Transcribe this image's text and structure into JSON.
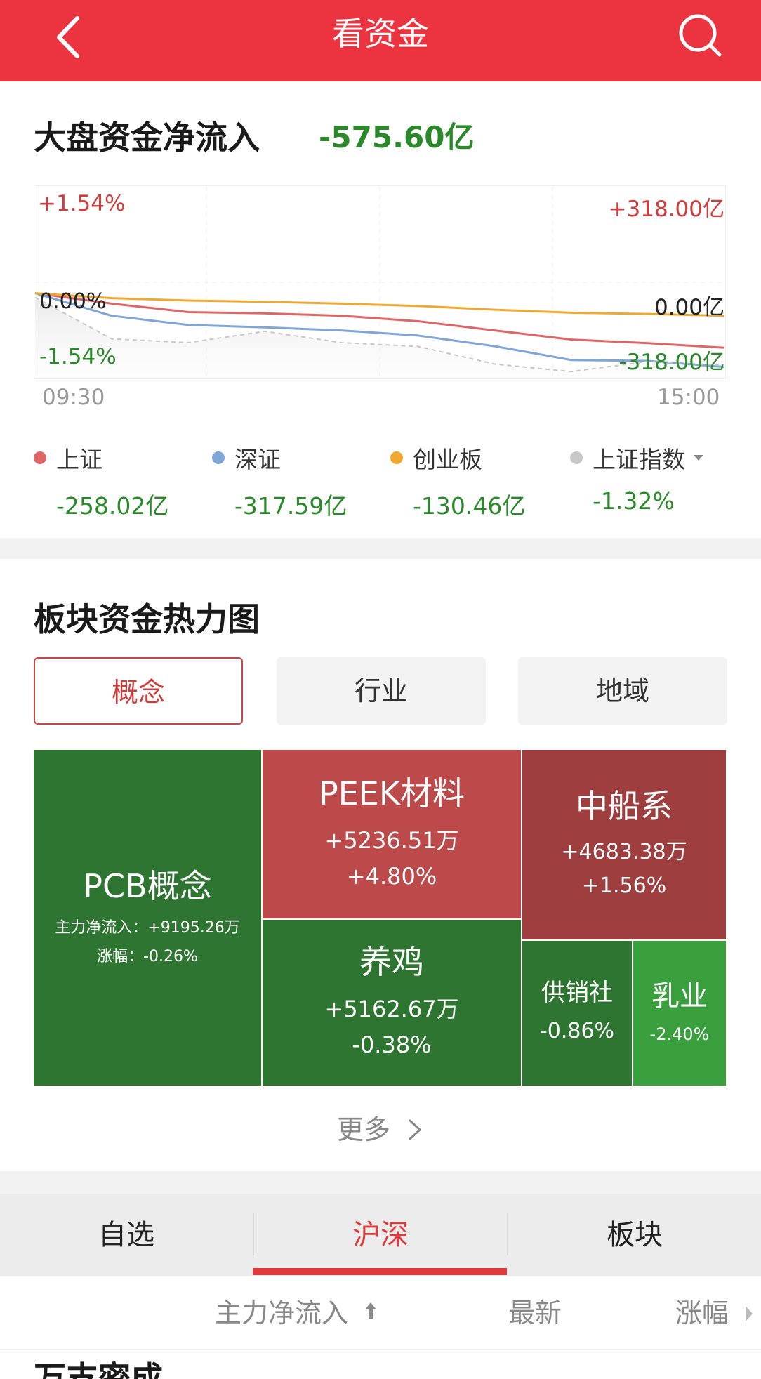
{
  "header": {
    "title": "看资金"
  },
  "market_flow": {
    "title": "大盘资金净流入",
    "value": "-575.60亿",
    "chart": {
      "y_left": [
        "+1.54%",
        "0.00%",
        "-1.54%"
      ],
      "y_right": [
        "+318.00亿",
        "0.00亿",
        "-318.00亿"
      ],
      "x_start": "09:30",
      "x_end": "15:00"
    },
    "legend": [
      {
        "label": "上证",
        "value": "-258.02亿",
        "color": "#e06666"
      },
      {
        "label": "深证",
        "value": "-317.59亿",
        "color": "#7ea6d8"
      },
      {
        "label": "创业板",
        "value": "-130.46亿",
        "color": "#f0a830"
      },
      {
        "label": "上证指数",
        "value": "-1.32%",
        "color": "#c8c8c8"
      }
    ]
  },
  "chart_data": {
    "type": "line",
    "x": [
      "09:30",
      "15:00"
    ],
    "ylim": [
      -318,
      318
    ],
    "series": [
      {
        "name": "上证",
        "color": "#e06666",
        "values": [
          -36,
          -70,
          -98,
          -102,
          -110,
          -128,
          -158,
          -188,
          -200,
          -215
        ]
      },
      {
        "name": "深证",
        "color": "#7ea6d8",
        "values": [
          -36,
          -110,
          -140,
          -148,
          -158,
          -175,
          -210,
          -255,
          -258,
          -278
        ]
      },
      {
        "name": "创业板",
        "color": "#f0a830",
        "values": [
          -36,
          -52,
          -60,
          -64,
          -70,
          -78,
          -90,
          -100,
          -104,
          -110
        ]
      },
      {
        "name": "上证指数",
        "color": "#c8c8c8",
        "values": [
          -0.24,
          -0.9,
          -0.96,
          -0.78,
          -0.96,
          -1.02,
          -1.3,
          -1.42,
          -1.26,
          -1.32
        ]
      }
    ]
  },
  "heatmap": {
    "title": "板块资金热力图",
    "tabs": [
      "概念",
      "行业",
      "地域"
    ],
    "tiles": [
      {
        "name": "PCB概念",
        "line1": "主力净流入：+9195.26万",
        "line2": "涨幅：-0.26%",
        "bg": "#2e7532"
      },
      {
        "name": "PEEK材料",
        "line1": "+5236.51万",
        "line2": "+4.80%",
        "bg": "#bd4a4a"
      },
      {
        "name": "中船系",
        "line1": "+4683.38万",
        "line2": "+1.56%",
        "bg": "#9e3e3e"
      },
      {
        "name": "养鸡",
        "line1": "+5162.67万",
        "line2": "-0.38%",
        "bg": "#2e7532"
      },
      {
        "name": "供销社",
        "line1": "-0.86%",
        "bg": "#2e7532"
      },
      {
        "name": "乳业",
        "line1": "-2.40%",
        "bg": "#3aa03e"
      }
    ],
    "more": "更多"
  },
  "bottom_tabs": [
    "自选",
    "沪深",
    "板块"
  ],
  "sort_bar": {
    "col1": "主力净流入",
    "col2": "最新",
    "col3": "涨幅"
  },
  "next_section_title": "万支密成"
}
